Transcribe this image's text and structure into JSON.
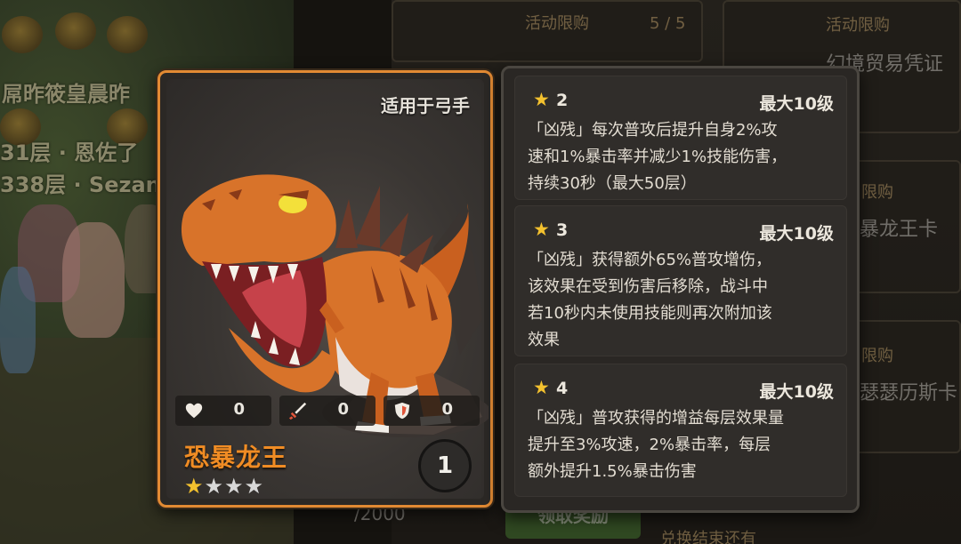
{
  "background": {
    "left_texts": [
      "屌昨筱皇晨昨",
      "31层 · 恩佐了",
      "338层 · Sezan"
    ],
    "counter": "5 / 5",
    "event_label_1": "活动限购",
    "event_label_2": "活动限购",
    "event_label_3": "限购",
    "event_label_4": "限购",
    "item_1": "幻境贸易凭证",
    "item_2": "暴龙王卡",
    "item_3": "瑟瑟历斯卡",
    "progress": "/2000",
    "bottom_note": "兑换结束还有",
    "green_button": "领取奖励"
  },
  "card": {
    "applicable_to": "适用于弓手",
    "name": "恐暴龙王",
    "stars_total": 4,
    "stars_filled": 1,
    "star_on_glyph": "★",
    "star_off_glyph": "★★★",
    "count": "1",
    "stats": [
      {
        "icon": "heart-icon",
        "value": "0"
      },
      {
        "icon": "sword-icon",
        "value": "0"
      },
      {
        "icon": "shield-icon",
        "value": "0"
      }
    ],
    "colors": {
      "border": "#e28a33",
      "name": "#f08c24"
    }
  },
  "skills": [
    {
      "star": "★",
      "level": "2",
      "max": "最大10级",
      "lines": [
        "「凶残」每次普攻后提升自身2%攻",
        "速和1%暴击率并减少1%技能伤害，",
        "持续30秒（最大50层）"
      ]
    },
    {
      "star": "★",
      "level": "3",
      "max": "最大10级",
      "lines": [
        "「凶残」获得额外65%普攻增伤，",
        "该效果在受到伤害后移除，战斗中",
        "若10秒内未使用技能则再次附加该",
        "效果"
      ]
    },
    {
      "star": "★",
      "level": "4",
      "max": "最大10级",
      "lines": [
        "「凶残」普攻获得的增益每层效果量",
        "提升至3%攻速，2%暴击率，每层",
        "额外提升1.5%暴击伤害"
      ]
    }
  ]
}
